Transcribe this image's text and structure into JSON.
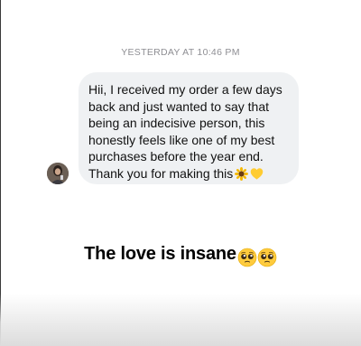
{
  "thread": {
    "timestamp": "YESTERDAY AT 10:46 PM"
  },
  "message": {
    "text": "Hii, I received my order a few days\nback and just wanted to say that\nbeing an indecisive person, this\nhonestly feels like one of my best\npurchases before the year end.\nThank you for making this",
    "trailing_emojis": [
      "sunflower-emoji",
      "yellow-heart-emoji"
    ],
    "bubble_color": "#eff1f3"
  },
  "sender": {
    "avatar_icon": "profile-photo-avatar"
  },
  "caption": {
    "text": "The love is insane",
    "trailing_emojis": [
      "pleading-face-emoji",
      "pleading-face-emoji"
    ]
  }
}
